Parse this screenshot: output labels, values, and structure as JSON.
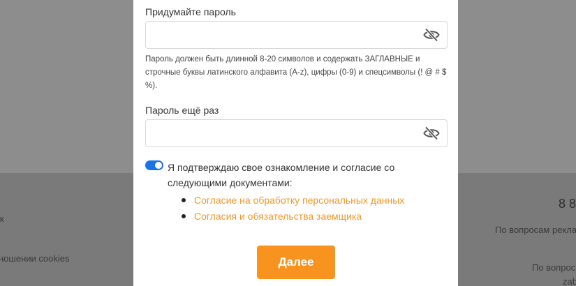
{
  "background": {
    "left_line_1": "кк",
    "left_line_2": "ношении cookies",
    "right_phone": "8 8",
    "right_line_1": "По вопросам рекла",
    "right_line_2": "По вопрос",
    "right_line_3": "zab"
  },
  "form": {
    "password_label": "Придумайте пароль",
    "password_value": "",
    "password_hint": "Пароль должен быть длинной 8-20 символов и содержать ЗАГЛАВНЫЕ и строчные буквы латинского алфавита (A-z), цифры (0-9) и спецсимволы (! @ # $ %).",
    "repeat_label": "Пароль ещё раз",
    "repeat_value": "",
    "consent_toggle_on": true,
    "consent_text": "Я подтверждаю свое ознакомление и согласие со следующими документами:",
    "documents": [
      "Согласие на обработку персональных данных",
      "Согласия и обязательства заемщика"
    ],
    "next_button": "Далее"
  },
  "colors": {
    "accent_orange": "#f7931e",
    "link_orange": "#f39624",
    "toggle_blue": "#1a73e8"
  },
  "icons": {
    "password_visibility": "eye-slash-icon"
  }
}
